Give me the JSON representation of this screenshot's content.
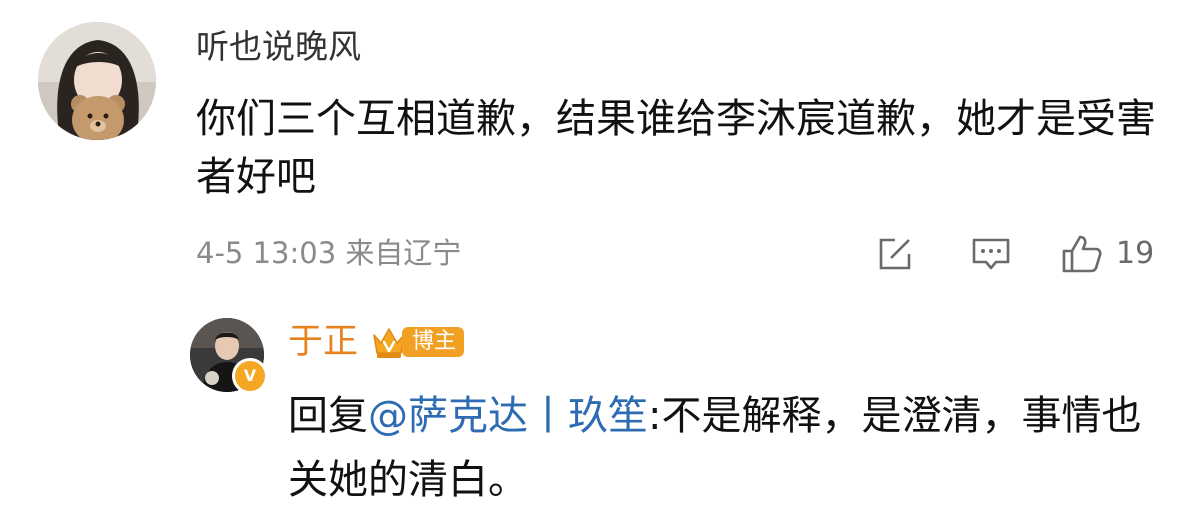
{
  "comment": {
    "username": "听也说晚风",
    "text": "你们三个互相道歉，结果谁给李沐宸道歉，她才是受害者好吧",
    "timestamp": "4-5 13:03",
    "location": "来自辽宁",
    "actions": {
      "edit_icon": "share-edit-icon",
      "comment_icon": "comment-icon",
      "like_icon": "thumbs-up-icon",
      "like_count": "19"
    }
  },
  "reply": {
    "username": "于正",
    "badge_label": "博主",
    "prefix": "回复",
    "mention": "@萨克达丨玖笙",
    "text": ":不是解释，是澄清，事情也关她的清白。",
    "verified_badge": "V"
  },
  "colors": {
    "reply_username": "#e8821e",
    "mention": "#2d6bb3",
    "badge": "#f2a024",
    "meta": "#8a8a8a"
  }
}
